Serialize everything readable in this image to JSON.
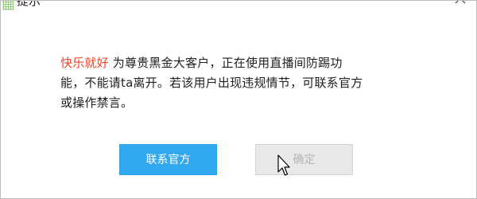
{
  "window": {
    "title": "提示",
    "icons": {
      "app": "app-grid-icon",
      "close": "close-icon"
    }
  },
  "message": {
    "username": "快乐就好",
    "line1_rest": " 为尊贵黑金大客户，正在使用直播间防踢功",
    "line2": "能，不能请ta离开。若该用户出现违规情节，可联系官方",
    "line3": "或操作禁言。"
  },
  "buttons": {
    "contact_official": "联系官方",
    "confirm": "确定"
  },
  "colors": {
    "username": "#e8452c",
    "primary_button": "#32a9ef",
    "disabled_button": "#e9e9e9",
    "disabled_text": "#b5b5b5"
  }
}
